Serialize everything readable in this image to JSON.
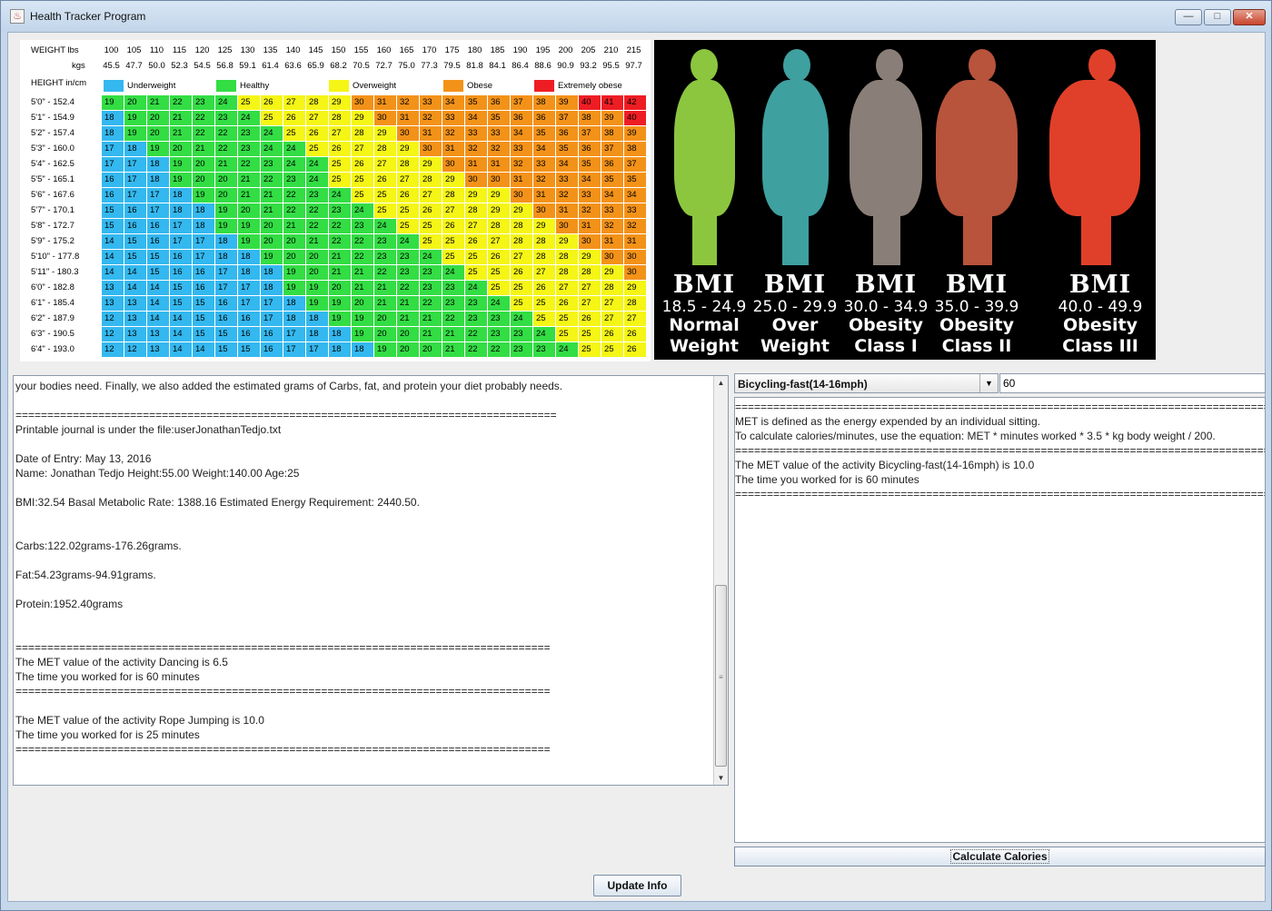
{
  "window": {
    "title": "Health Tracker Program",
    "minimize_glyph": "—",
    "maximize_glyph": "□",
    "close_glyph": "✕"
  },
  "bmi_table": {
    "weight_label": "WEIGHT lbs",
    "kgs_label": "kgs",
    "height_label": "HEIGHT in/cm",
    "weights_lbs": [
      "100",
      "105",
      "110",
      "115",
      "120",
      "125",
      "130",
      "135",
      "140",
      "145",
      "150",
      "155",
      "160",
      "165",
      "170",
      "175",
      "180",
      "185",
      "190",
      "195",
      "200",
      "205",
      "210",
      "215"
    ],
    "weights_kgs": [
      "45.5",
      "47.7",
      "50.0",
      "52.3",
      "54.5",
      "56.8",
      "59.1",
      "61.4",
      "63.6",
      "65.9",
      "68.2",
      "70.5",
      "72.7",
      "75.0",
      "77.3",
      "79.5",
      "81.8",
      "84.1",
      "86.4",
      "88.6",
      "90.9",
      "93.2",
      "95.5",
      "97.7"
    ],
    "legend": [
      {
        "label": "Underweight",
        "color": "#33b8ef"
      },
      {
        "label": "Healthy",
        "color": "#33dd44"
      },
      {
        "label": "Overweight",
        "color": "#f5f516"
      },
      {
        "label": "Obese",
        "color": "#f39218"
      },
      {
        "label": "Extremely obese",
        "color": "#ee1d24"
      }
    ],
    "heights": [
      "5'0\" - 152.4",
      "5'1\" - 154.9",
      "5'2\" - 157.4",
      "5'3\" - 160.0",
      "5'4\" - 162.5",
      "5'5\" - 165.1",
      "5'6\" - 167.6",
      "5'7\" - 170.1",
      "5'8\" - 172.7",
      "5'9\" - 175.2",
      "5'10\" - 177.8",
      "5'11\" - 180.3",
      "6'0\" - 182.8",
      "6'1\" - 185.4",
      "6'2\" - 187.9",
      "6'3\" - 190.5",
      "6'4\" - 193.0"
    ],
    "rows": [
      [
        19,
        20,
        21,
        22,
        23,
        24,
        25,
        26,
        27,
        28,
        29,
        30,
        31,
        32,
        33,
        34,
        35,
        36,
        37,
        38,
        39,
        40,
        41,
        42
      ],
      [
        18,
        19,
        20,
        21,
        22,
        23,
        24,
        25,
        26,
        27,
        28,
        29,
        30,
        31,
        32,
        33,
        34,
        35,
        36,
        36,
        37,
        38,
        39,
        40
      ],
      [
        18,
        19,
        20,
        21,
        22,
        22,
        23,
        24,
        25,
        26,
        27,
        28,
        29,
        30,
        31,
        32,
        33,
        33,
        34,
        35,
        36,
        37,
        38,
        39
      ],
      [
        17,
        18,
        19,
        20,
        21,
        22,
        23,
        24,
        24,
        25,
        26,
        27,
        28,
        29,
        30,
        31,
        32,
        32,
        33,
        34,
        35,
        36,
        37,
        38
      ],
      [
        17,
        17,
        18,
        19,
        20,
        21,
        22,
        23,
        24,
        24,
        25,
        26,
        27,
        28,
        29,
        30,
        31,
        31,
        32,
        33,
        34,
        35,
        36,
        37
      ],
      [
        16,
        17,
        18,
        19,
        20,
        20,
        21,
        22,
        23,
        24,
        25,
        25,
        26,
        27,
        28,
        29,
        30,
        30,
        31,
        32,
        33,
        34,
        35,
        35
      ],
      [
        16,
        17,
        17,
        18,
        19,
        20,
        21,
        21,
        22,
        23,
        24,
        25,
        25,
        26,
        27,
        28,
        29,
        29,
        30,
        31,
        32,
        33,
        34,
        34
      ],
      [
        15,
        16,
        17,
        18,
        18,
        19,
        20,
        21,
        22,
        22,
        23,
        24,
        25,
        25,
        26,
        27,
        28,
        29,
        29,
        30,
        31,
        32,
        33,
        33
      ],
      [
        15,
        16,
        16,
        17,
        18,
        19,
        19,
        20,
        21,
        22,
        22,
        23,
        24,
        25,
        25,
        26,
        27,
        28,
        28,
        29,
        30,
        31,
        32,
        32
      ],
      [
        14,
        15,
        16,
        17,
        17,
        18,
        19,
        20,
        20,
        21,
        22,
        22,
        23,
        24,
        25,
        25,
        26,
        27,
        28,
        28,
        29,
        30,
        31,
        31
      ],
      [
        14,
        15,
        15,
        16,
        17,
        18,
        18,
        19,
        20,
        20,
        21,
        22,
        23,
        23,
        24,
        25,
        25,
        26,
        27,
        28,
        28,
        29,
        30,
        30
      ],
      [
        14,
        14,
        15,
        16,
        16,
        17,
        18,
        18,
        19,
        20,
        21,
        21,
        22,
        23,
        23,
        24,
        25,
        25,
        26,
        27,
        28,
        28,
        29,
        30
      ],
      [
        13,
        14,
        14,
        15,
        16,
        17,
        17,
        18,
        19,
        19,
        20,
        21,
        21,
        22,
        23,
        23,
        24,
        25,
        25,
        26,
        27,
        27,
        28,
        29
      ],
      [
        13,
        13,
        14,
        15,
        15,
        16,
        17,
        17,
        18,
        19,
        19,
        20,
        21,
        21,
        22,
        23,
        23,
        24,
        25,
        25,
        26,
        27,
        27,
        28
      ],
      [
        12,
        13,
        14,
        14,
        15,
        16,
        16,
        17,
        18,
        18,
        19,
        19,
        20,
        21,
        21,
        22,
        23,
        23,
        24,
        25,
        25,
        26,
        27,
        27
      ],
      [
        12,
        13,
        13,
        14,
        15,
        15,
        16,
        16,
        17,
        18,
        18,
        19,
        20,
        20,
        21,
        21,
        22,
        23,
        23,
        24,
        25,
        25,
        26,
        26
      ],
      [
        12,
        12,
        13,
        14,
        14,
        15,
        15,
        16,
        17,
        17,
        18,
        18,
        19,
        20,
        20,
        21,
        22,
        22,
        23,
        23,
        24,
        25,
        25,
        26
      ]
    ]
  },
  "bmi_image": {
    "figures": [
      {
        "line1": "BMI",
        "line2": "18.5 - 24.9",
        "line3": "Normal",
        "line4": "Weight",
        "color": "#8cc63f"
      },
      {
        "line1": "BMI",
        "line2": "25.0 - 29.9",
        "line3": "Over",
        "line4": "Weight",
        "color": "#3fa0a0"
      },
      {
        "line1": "BMI",
        "line2": "30.0 - 34.9",
        "line3": "Obesity",
        "line4": "Class I",
        "color": "#8a7f78"
      },
      {
        "line1": "BMI",
        "line2": "35.0 - 39.9",
        "line3": "Obesity",
        "line4": "Class II",
        "color": "#b8533c"
      },
      {
        "line1": "BMI",
        "line2": "40.0 - 49.9",
        "line3": "Obesity",
        "line4": "Class III",
        "color": "#e0402a"
      }
    ]
  },
  "journal": {
    "lines": [
      "your bodies need. Finally, we also added the estimated grams of Carbs, fat, and protein your diet probably needs.",
      "",
      "=====================================================================================",
      "Printable journal is under the file:userJonathanTedjo.txt",
      "",
      "Date of Entry: May 13, 2016",
      "Name: Jonathan Tedjo Height:55.00 Weight:140.00 Age:25",
      "",
      "BMI:32.54 Basal Metabolic Rate: 1388.16 Estimated Energy Requirement: 2440.50.",
      "",
      "",
      "Carbs:122.02grams-176.26grams.",
      "",
      "Fat:54.23grams-94.91grams.",
      "",
      "Protein:1952.40grams",
      "",
      "",
      "====================================================================================",
      "The MET value of the activity Dancing is 6.5",
      "The time you worked for is 60 minutes",
      "====================================================================================",
      "",
      "The MET value of the activity Rope Jumping is 10.0",
      "The time you worked for is 25 minutes",
      "===================================================================================="
    ],
    "scroll_up": "▲",
    "scroll_down": "▼",
    "thumb_grip": "≡"
  },
  "activity": {
    "selected": "Bicycling-fast(14-16mph)",
    "dropdown_arrow": "▼",
    "minutes_value": "60",
    "result_lines": [
      "============================================================================================",
      "MET is defined  as the energy expended by an individual sitting.",
      "To calculate calories/minutes, use the equation: MET * minutes worked * 3.5 * kg body weight / 200.",
      "============================================================================================",
      "The MET value of the activity Bicycling-fast(14-16mph) is 10.0",
      "The time you worked for is 60 minutes",
      "============================================================================================"
    ],
    "calculate_label": "Calculate Calories"
  },
  "footer": {
    "update_label": "Update Info"
  }
}
